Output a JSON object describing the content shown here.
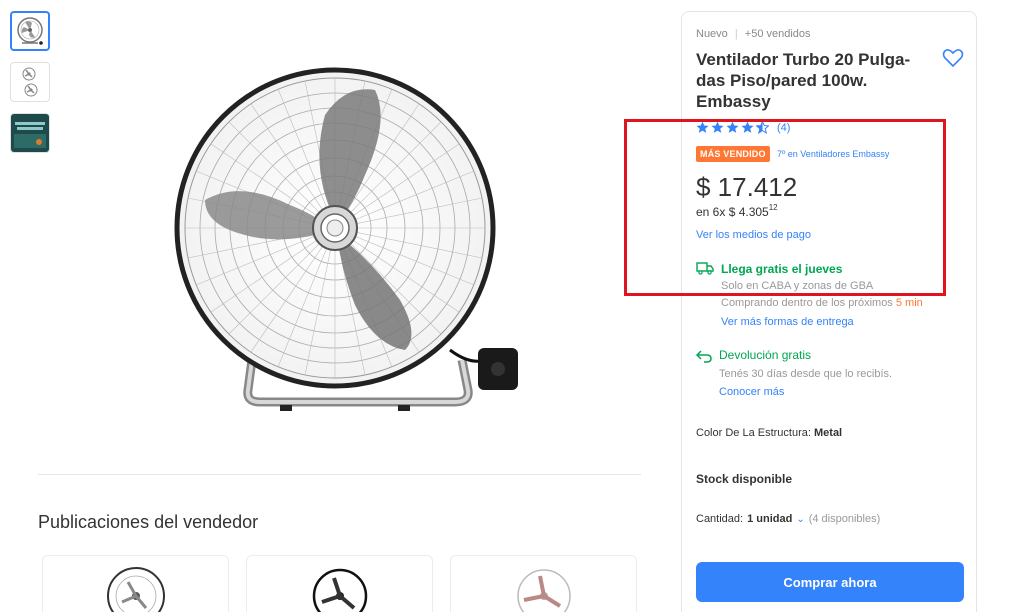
{
  "thumbnails": [
    {
      "name": "fan-front",
      "active": true
    },
    {
      "name": "fan-views",
      "active": false
    },
    {
      "name": "promo",
      "active": false
    }
  ],
  "seller": {
    "title": "Publicaciones del vendedor"
  },
  "product": {
    "condition": "Nuevo",
    "sold": "+50 vendidos",
    "title": "Ventilador Turbo 20 Pulga-das Piso/pared 100w. Embassy",
    "rating_count": "(4)",
    "rating_value": 4.5,
    "badge": "MÁS VENDIDO",
    "rank": "7º en Ventiladores Embassy",
    "price": "$ 17.412",
    "installments_prefix": "en 6x $ 4.305",
    "installments_cents": "12",
    "payment_link": "Ver los medios de pago"
  },
  "shipping": {
    "main": "Llega gratis el jueves",
    "zone": "Solo en CABA y zonas de GBA",
    "deadline_prefix": "Comprando dentro de los próximos",
    "deadline_time": "5 min",
    "link": "Ver más formas de entrega"
  },
  "returns": {
    "main": "Devolución gratis",
    "sub": "Tenés 30 días desde que lo recibís.",
    "link": "Conocer más"
  },
  "attributes": {
    "color_label": "Color De La Estructura:",
    "color_value": "Metal",
    "stock": "Stock disponible",
    "qty_label": "Cantidad:",
    "qty_value": "1 unidad",
    "qty_available": "(4 disponibles)"
  },
  "actions": {
    "buy_label": "Comprar ahora"
  },
  "colors": {
    "accent": "#3483fa",
    "green": "#00a650",
    "orange": "#ff7733",
    "highlight": "#e0141e"
  }
}
